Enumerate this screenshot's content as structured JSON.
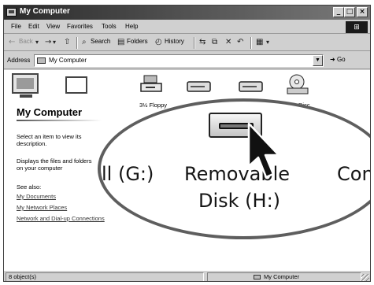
{
  "window": {
    "title": "My Computer",
    "minimize": "_",
    "maximize": "□",
    "close": "×"
  },
  "menu": {
    "items": [
      "File",
      "Edit",
      "View",
      "Favorites",
      "Tools",
      "Help"
    ]
  },
  "toolbar": {
    "back": "Back",
    "search": "Search",
    "folders": "Folders",
    "history": "History",
    "icons": {
      "back": "←",
      "forward": "→",
      "up": "⇧",
      "search": "⌕",
      "folders": "▤",
      "history": "◴",
      "move": "⇆",
      "copy": "⧉",
      "delete": "✕",
      "undo": "↶",
      "views": "▦"
    }
  },
  "address": {
    "label": "Address",
    "value": "My Computer",
    "go": "Go"
  },
  "sidebar": {
    "title": "My Computer",
    "description": "Select an item to view its description.",
    "info": "Displays the files and folders on your computer",
    "see_also": "See also:",
    "links": [
      "My Documents",
      "My Network Places",
      "Network and Dial-up Connections"
    ]
  },
  "drives": [
    {
      "label": "3½ Floppy",
      "icon": "floppy-drive-icon"
    },
    {
      "label": "",
      "icon": "hard-drive-icon"
    },
    {
      "label": "",
      "icon": "hard-drive-icon"
    },
    {
      "label": "Disc",
      "icon": "cd-drive-icon"
    }
  ],
  "zoom": {
    "left": "ll (G:)",
    "drive_line1": "Removable",
    "drive_line2": "Disk (H:)",
    "right": "Con"
  },
  "status": {
    "objects": "8 object(s)",
    "location": "My Computer"
  }
}
